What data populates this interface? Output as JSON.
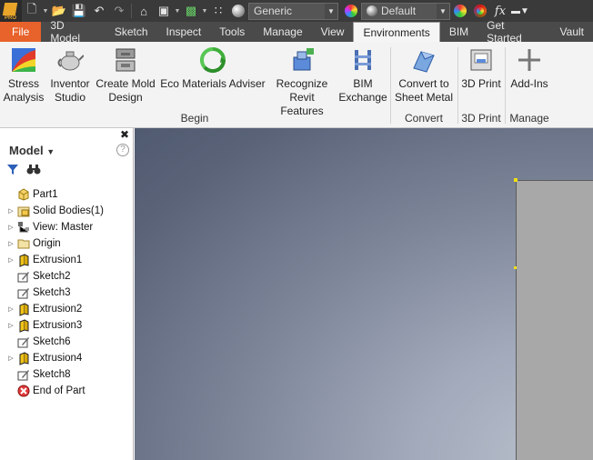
{
  "qat": {
    "material_value": "Generic",
    "appearance_value": "Default",
    "fx_label": "fx"
  },
  "tabs": [
    "File",
    "3D Model",
    "Sketch",
    "Inspect",
    "Tools",
    "Manage",
    "View",
    "Environments",
    "BIM",
    "Get Started",
    "Vault"
  ],
  "ribbon": {
    "stress_analysis": "Stress Analysis",
    "inventor_studio": "Inventor Studio",
    "create_mold_design": "Create Mold Design",
    "eco_materials_adviser": "Eco Materials Adviser",
    "recognize_revit_features": "Recognize Revit Features",
    "bim_exchange": "BIM Exchange",
    "convert_to_sheet_metal": "Convert to Sheet Metal",
    "3d_print": "3D Print",
    "add_ins": "Add-Ins",
    "groups": {
      "begin": "Begin",
      "convert": "Convert",
      "print": "3D Print",
      "manage": "Manage"
    }
  },
  "browser": {
    "title": "Model",
    "help": "?",
    "items": [
      "Part1",
      "Solid Bodies(1)",
      "View: Master",
      "Origin",
      "Extrusion1",
      "Sketch2",
      "Sketch3",
      "Extrusion2",
      "Extrusion3",
      "Sketch6",
      "Extrusion4",
      "Sketch8",
      "End of Part"
    ]
  },
  "colors": {
    "file_tab": "#e8622b",
    "dark_bar": "#3a3a3a",
    "tab_bar": "#4a4a4a",
    "ribbon_bg": "#f3f3f3",
    "part_face": "#a8a8a8"
  }
}
